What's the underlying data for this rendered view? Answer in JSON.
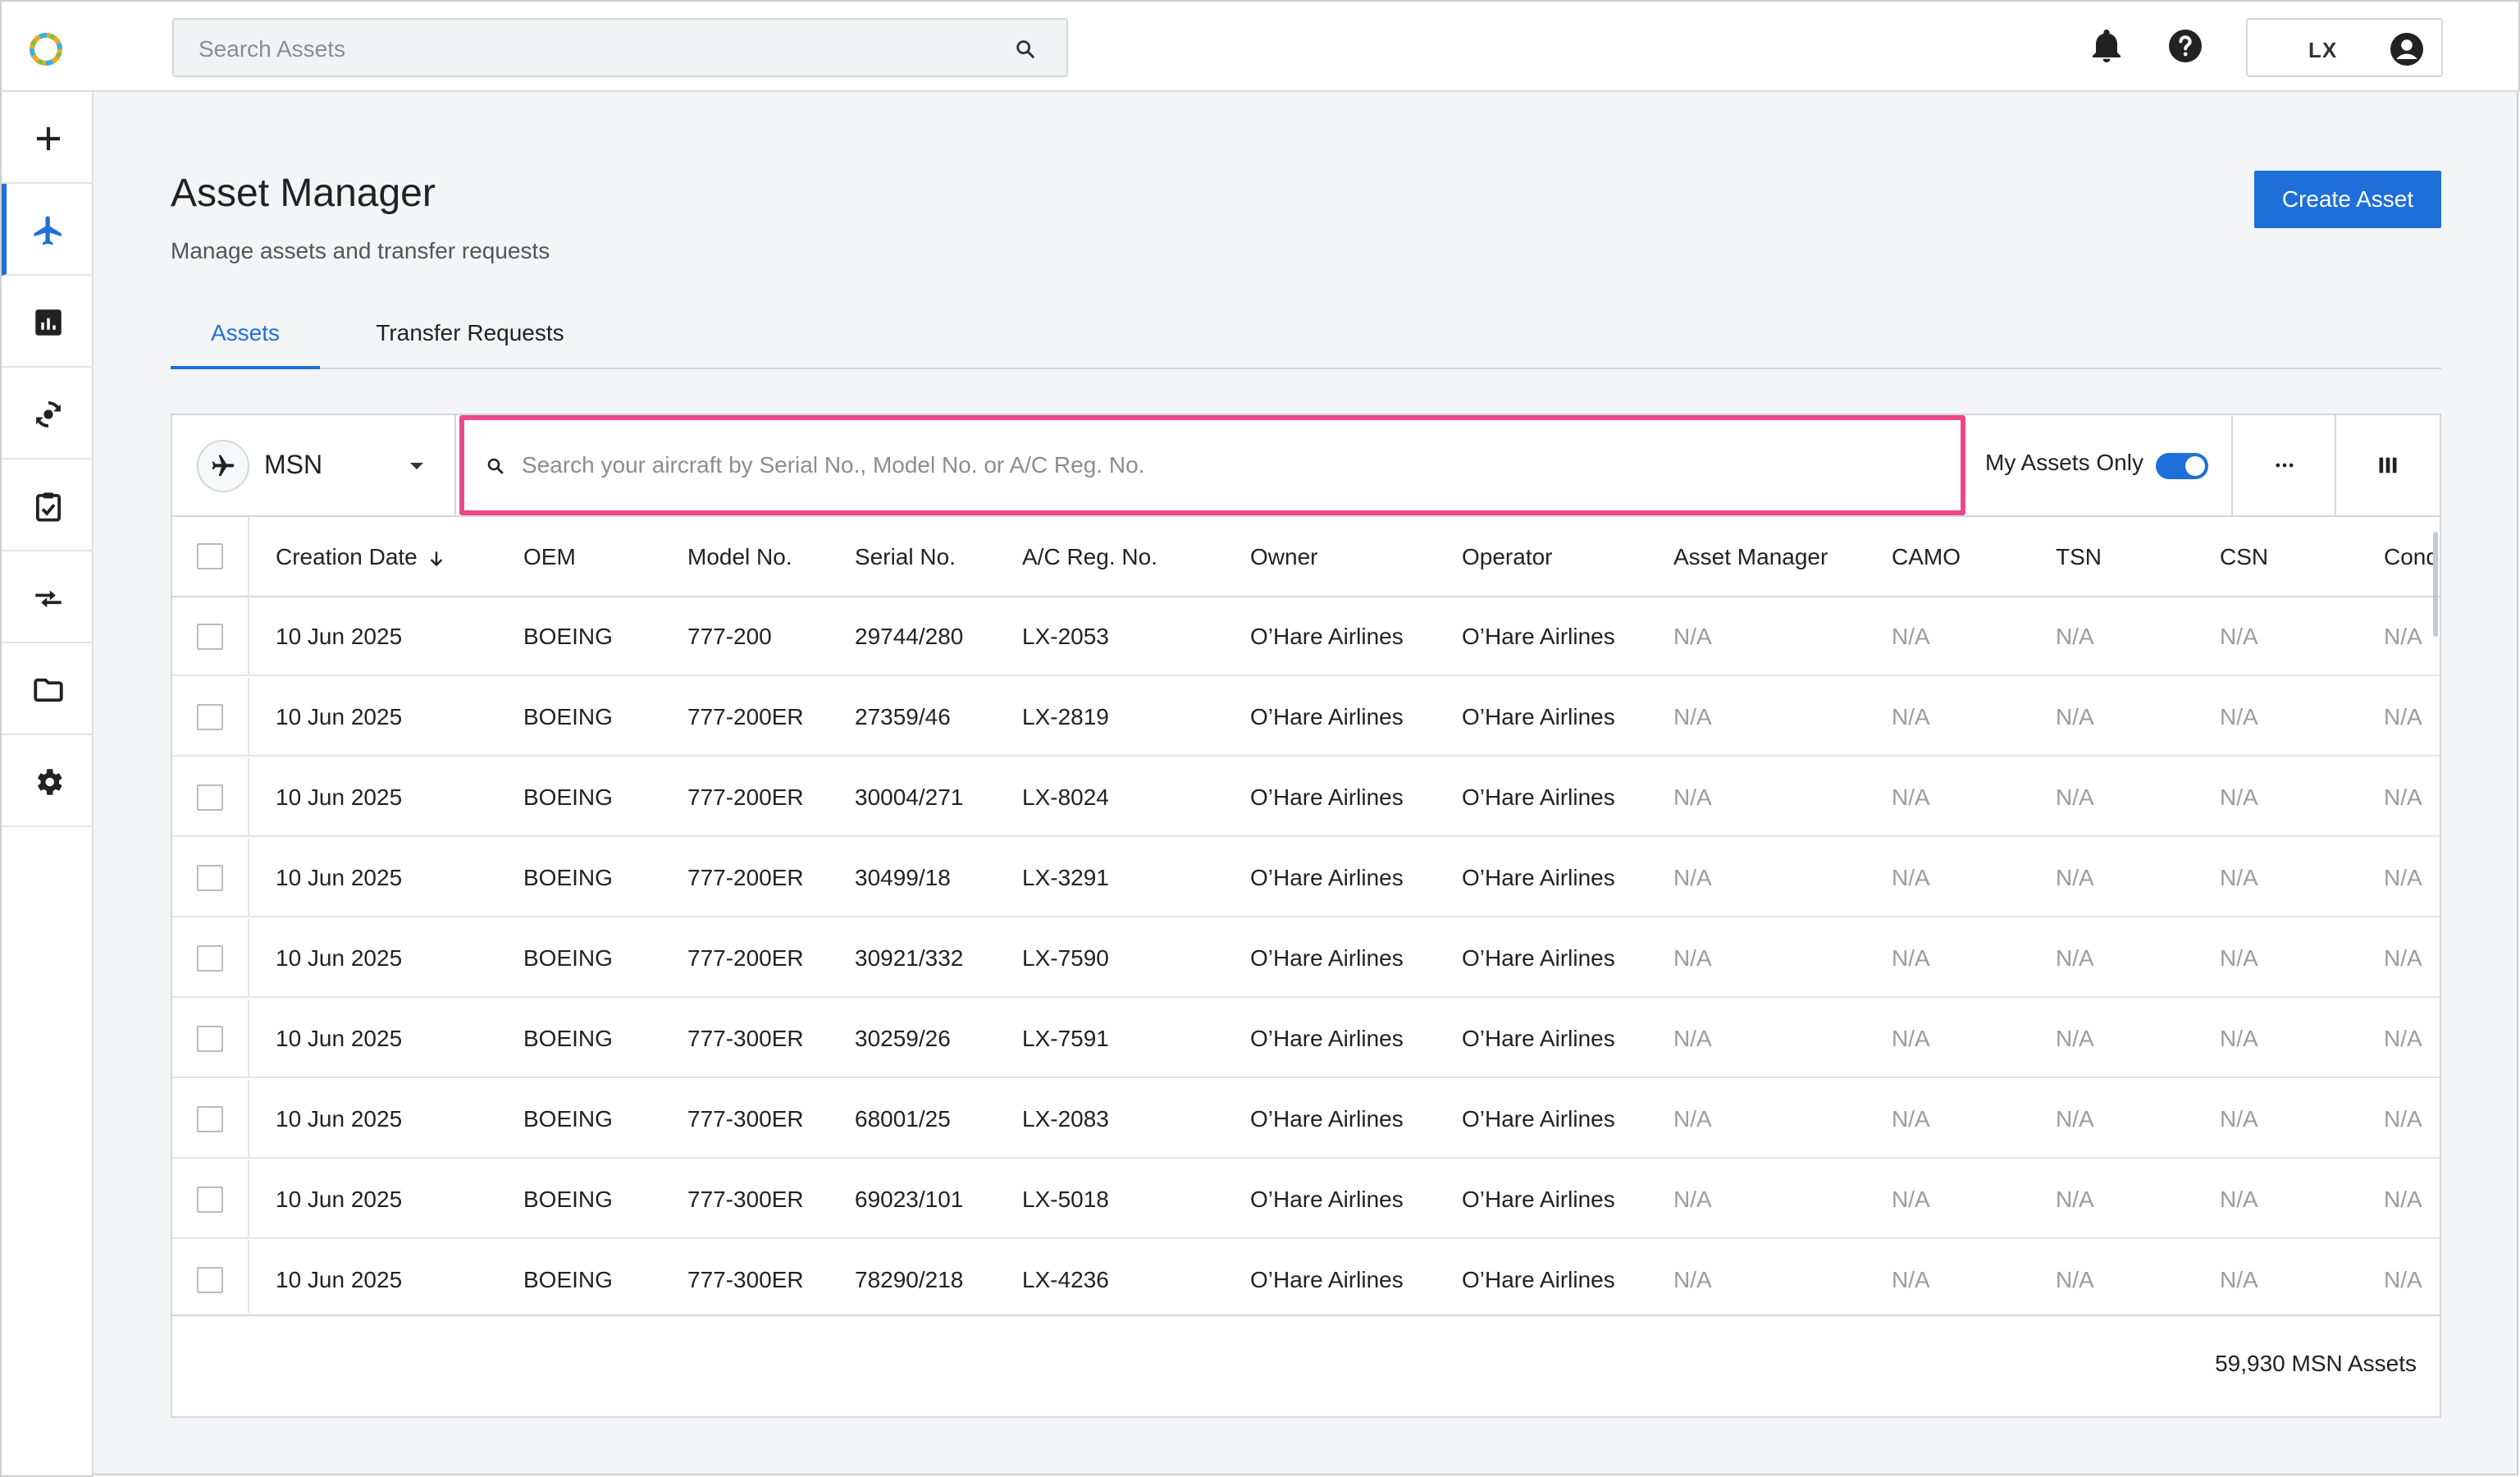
{
  "topbar": {
    "search_placeholder": "Search Assets",
    "user_initials": "LX"
  },
  "sidenav": {
    "items": [
      {
        "icon": "plus-icon"
      },
      {
        "icon": "airplane-icon",
        "active": true
      },
      {
        "icon": "chart-icon"
      },
      {
        "icon": "sync-icon"
      },
      {
        "icon": "clipboard-check-icon"
      },
      {
        "icon": "transfer-icon"
      },
      {
        "icon": "folder-icon"
      },
      {
        "icon": "gear-icon"
      }
    ]
  },
  "page": {
    "title": "Asset Manager",
    "subtitle": "Manage assets and transfer requests",
    "create_button": "Create Asset"
  },
  "tabs": [
    {
      "label": "Assets",
      "active": true
    },
    {
      "label": "Transfer Requests",
      "active": false
    }
  ],
  "toolbar": {
    "selector_label": "MSN",
    "search_placeholder": "Search your aircraft by Serial No., Model No. or A/C Reg. No.",
    "my_assets_label": "My Assets Only",
    "my_assets_on": true
  },
  "table": {
    "columns": [
      "Creation Date",
      "OEM",
      "Model No.",
      "Serial No.",
      "A/C Reg. No.",
      "Owner",
      "Operator",
      "Asset Manager",
      "CAMO",
      "TSN",
      "CSN",
      "Cond"
    ],
    "rows": [
      [
        "10 Jun 2025",
        "BOEING",
        "777-200",
        "29744/280",
        "LX-2053",
        "O’Hare Airlines",
        "O’Hare Airlines",
        "N/A",
        "N/A",
        "N/A",
        "N/A",
        "N/A"
      ],
      [
        "10 Jun 2025",
        "BOEING",
        "777-200ER",
        "27359/46",
        "LX-2819",
        "O’Hare Airlines",
        "O’Hare Airlines",
        "N/A",
        "N/A",
        "N/A",
        "N/A",
        "N/A"
      ],
      [
        "10 Jun 2025",
        "BOEING",
        "777-200ER",
        "30004/271",
        "LX-8024",
        "O’Hare Airlines",
        "O’Hare Airlines",
        "N/A",
        "N/A",
        "N/A",
        "N/A",
        "N/A"
      ],
      [
        "10 Jun 2025",
        "BOEING",
        "777-200ER",
        "30499/18",
        "LX-3291",
        "O’Hare Airlines",
        "O’Hare Airlines",
        "N/A",
        "N/A",
        "N/A",
        "N/A",
        "N/A"
      ],
      [
        "10 Jun 2025",
        "BOEING",
        "777-200ER",
        "30921/332",
        "LX-7590",
        "O’Hare Airlines",
        "O’Hare Airlines",
        "N/A",
        "N/A",
        "N/A",
        "N/A",
        "N/A"
      ],
      [
        "10 Jun 2025",
        "BOEING",
        "777-300ER",
        "30259/26",
        "LX-7591",
        "O’Hare Airlines",
        "O’Hare Airlines",
        "N/A",
        "N/A",
        "N/A",
        "N/A",
        "N/A"
      ],
      [
        "10 Jun 2025",
        "BOEING",
        "777-300ER",
        "68001/25",
        "LX-2083",
        "O’Hare Airlines",
        "O’Hare Airlines",
        "N/A",
        "N/A",
        "N/A",
        "N/A",
        "N/A"
      ],
      [
        "10 Jun 2025",
        "BOEING",
        "777-300ER",
        "69023/101",
        "LX-5018",
        "O’Hare Airlines",
        "O’Hare Airlines",
        "N/A",
        "N/A",
        "N/A",
        "N/A",
        "N/A"
      ],
      [
        "10 Jun 2025",
        "BOEING",
        "777-300ER",
        "78290/218",
        "LX-4236",
        "O’Hare Airlines",
        "O’Hare Airlines",
        "N/A",
        "N/A",
        "N/A",
        "N/A",
        "N/A"
      ]
    ]
  },
  "footer": {
    "count_label": "59,930 MSN Assets"
  },
  "colors": {
    "accent": "#1e6fd9",
    "highlight": "#ec4888"
  }
}
